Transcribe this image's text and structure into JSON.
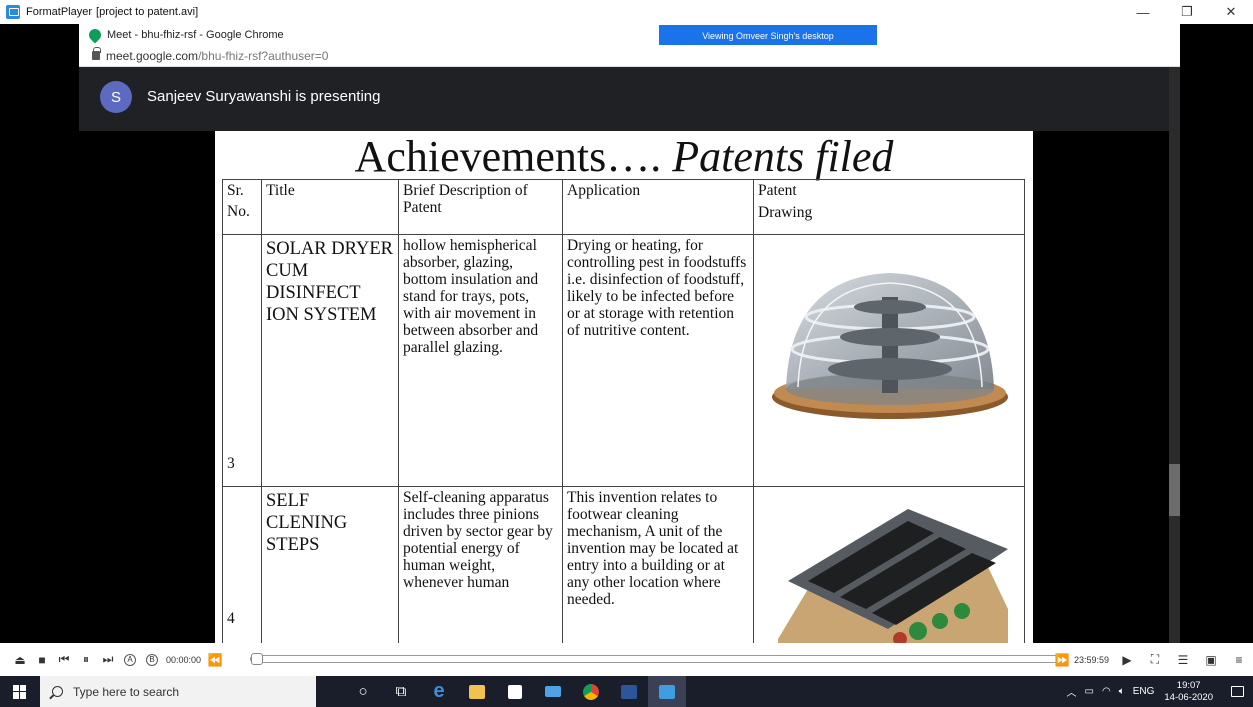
{
  "player": {
    "app_name": "FormatPlayer",
    "file": "[project to patent.avi]",
    "current_time": "00:00:00",
    "remaining_time": "23:59:59",
    "ab_a": "A",
    "ab_b": "B"
  },
  "chrome": {
    "window_title": "Meet - bhu-fhiz-rsf - Google Chrome",
    "url_host": "meet.google.com",
    "url_path": "/bhu-fhiz-rsf?authuser=0",
    "banner": "Viewing Omveer Singh's desktop"
  },
  "meet": {
    "avatar_letter": "S",
    "presenting_text": "Sanjeev Suryawanshi is presenting"
  },
  "slide": {
    "title_main": "Achievements….",
    "title_italic": "Patents filed",
    "headers": {
      "sr": "Sr.",
      "sr2": "No.",
      "title": "Title",
      "description": "Brief Description of Patent",
      "application": "Application",
      "drawing": "Patent",
      "drawing2": "Drawing"
    },
    "rows": [
      {
        "sr": "3",
        "title": " SOLAR DRYER CUM DISINFECT ION SYSTEM",
        "description": "hollow hemispherical absorber, glazing, bottom insulation and stand for trays, pots, with air movement in between absorber and parallel glazing.",
        "application": "Drying or heating, for controlling pest in foodstuffs i.e. disinfection  of foodstuff, likely to be infected before or at storage with retention of nutritive content."
      },
      {
        "sr": "4",
        "title": "SELF CLENING STEPS",
        "description": "Self-cleaning apparatus includes three pinions driven by sector gear by potential energy of human weight, whenever human",
        "application": "This invention relates to footwear cleaning mechanism, A unit of the invention may be located at entry into a building or at any other location where needed."
      }
    ]
  },
  "taskbar": {
    "search_placeholder": "Type here to search",
    "lang": "ENG",
    "time": "19:07",
    "date": "14-06-2020"
  }
}
